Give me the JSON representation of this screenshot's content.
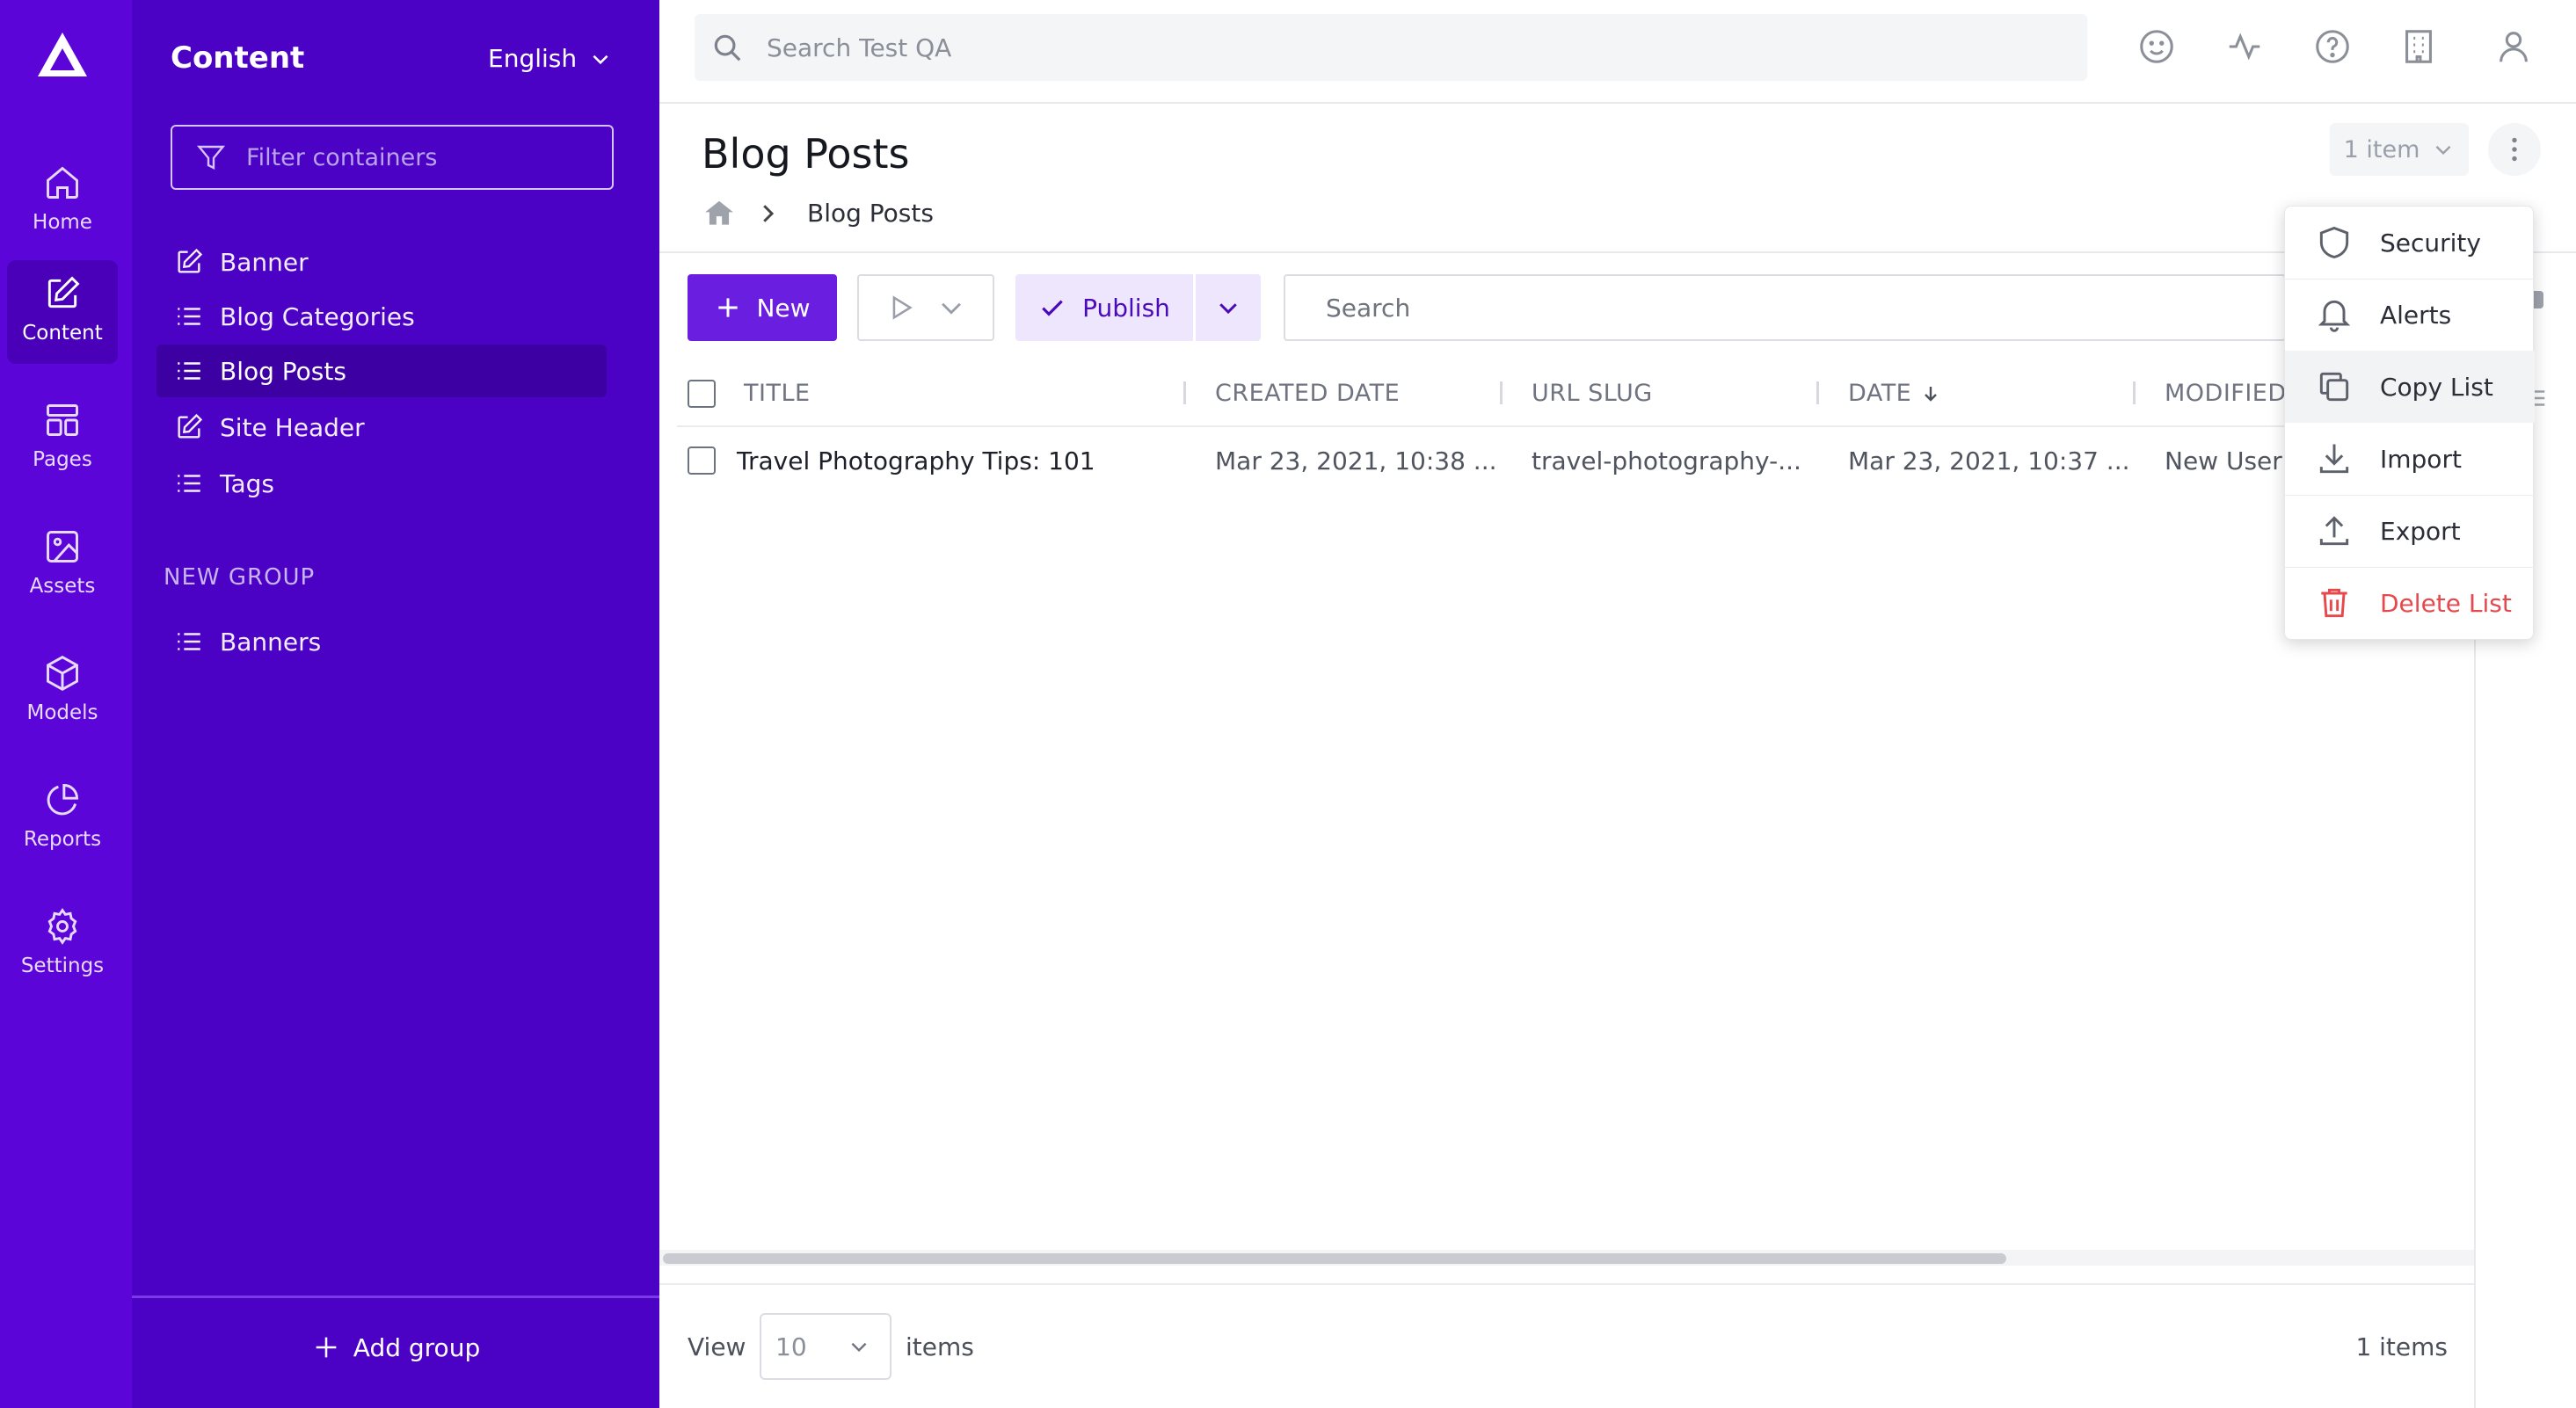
{
  "rail": {
    "items": [
      {
        "label": "Home",
        "icon": "home-icon"
      },
      {
        "label": "Content",
        "icon": "edit-icon"
      },
      {
        "label": "Pages",
        "icon": "layout-icon"
      },
      {
        "label": "Assets",
        "icon": "image-icon"
      },
      {
        "label": "Models",
        "icon": "cube-icon"
      },
      {
        "label": "Reports",
        "icon": "pie-chart-icon"
      },
      {
        "label": "Settings",
        "icon": "gear-icon"
      }
    ],
    "active": "Content",
    "color": "#5c05d8"
  },
  "side": {
    "title": "Content",
    "language": "English",
    "filter_placeholder": "Filter containers",
    "items": [
      {
        "label": "Banner",
        "icon": "edit-icon"
      },
      {
        "label": "Blog Categories",
        "icon": "list-icon"
      },
      {
        "label": "Blog Posts",
        "icon": "list-icon"
      },
      {
        "label": "Site Header",
        "icon": "edit-icon"
      },
      {
        "label": "Tags",
        "icon": "list-icon"
      }
    ],
    "group": {
      "label": "NEW GROUP",
      "items": [
        {
          "label": "Banners",
          "icon": "list-icon"
        }
      ]
    },
    "add_group": "Add group",
    "color": "#4c02c4"
  },
  "topbar": {
    "search_placeholder": "Search Test QA",
    "icons": [
      "smiley-icon",
      "activity-icon",
      "help-icon",
      "building-icon",
      "user-icon"
    ]
  },
  "header": {
    "title": "Blog Posts",
    "breadcrumb": "Blog Posts",
    "item_count": "1 item"
  },
  "toolbar": {
    "new_label": "New",
    "publish_label": "Publish",
    "search_placeholder": "Search",
    "accent": "#6a1ee0"
  },
  "table": {
    "columns": [
      "TITLE",
      "CREATED DATE",
      "URL SLUG",
      "DATE",
      "MODIFIED"
    ],
    "rows": [
      {
        "title": "Travel Photography Tips: 101",
        "created": "Mar 23, 2021, 10:38 ...",
        "slug": "travel-photography-...",
        "date": "Mar 23, 2021, 10:37 ...",
        "modified": "New User"
      }
    ]
  },
  "footer": {
    "view": "View",
    "page_size": "10",
    "items": "items",
    "total": "1 items"
  },
  "menu": {
    "items": [
      {
        "label": "Security",
        "icon": "shield-icon"
      },
      {
        "label": "Alerts",
        "icon": "bell-icon"
      },
      {
        "label": "Copy List",
        "icon": "copy-icon"
      },
      {
        "label": "Import",
        "icon": "download-icon"
      },
      {
        "label": "Export",
        "icon": "upload-icon"
      },
      {
        "label": "Delete List",
        "icon": "trash-icon"
      }
    ],
    "danger_color": "#e5484d"
  }
}
